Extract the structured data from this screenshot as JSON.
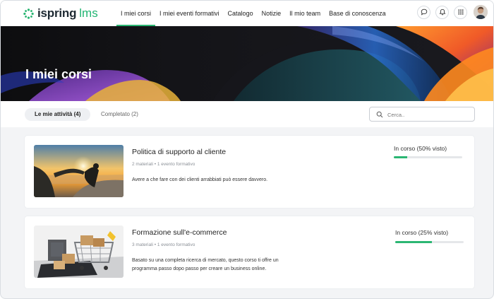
{
  "brand": {
    "name": "ispring",
    "suffix": "lms",
    "accent_color": "#2bb673"
  },
  "nav": {
    "items": [
      {
        "label": "I miei corsi",
        "active": true
      },
      {
        "label": "I miei eventi formativi",
        "active": false
      },
      {
        "label": "Catalogo",
        "active": false
      },
      {
        "label": "Notizie",
        "active": false
      },
      {
        "label": "Il mio team",
        "active": false
      },
      {
        "label": "Base di conoscenza",
        "active": false
      }
    ],
    "icons": [
      "chat-icon",
      "bell-icon",
      "grid-icon"
    ]
  },
  "hero": {
    "title": "I miei corsi"
  },
  "tabs": [
    {
      "label": "Le mie attività (4)",
      "active": true
    },
    {
      "label": "Completato (2)",
      "active": false
    }
  ],
  "search": {
    "placeholder": "Cerca..",
    "value": ""
  },
  "courses": [
    {
      "title": "Politica di supporto al cliente",
      "meta": "2 materiali • 1 evento formativo",
      "description": "Avere a che fare con dei clienti arrabbiati può essere davvero.",
      "status": "In corso (50% visto)",
      "progress": 0.2
    },
    {
      "title": "Formazione sull'e-commerce",
      "meta": "3 materiali • 1 evento formativo",
      "description": "Basato su una completa ricerca di mercato, questo corso ti offre un programma passo dopo passo per creare un business online.",
      "status": "In corso (25% visto)",
      "progress": 0.54
    }
  ]
}
